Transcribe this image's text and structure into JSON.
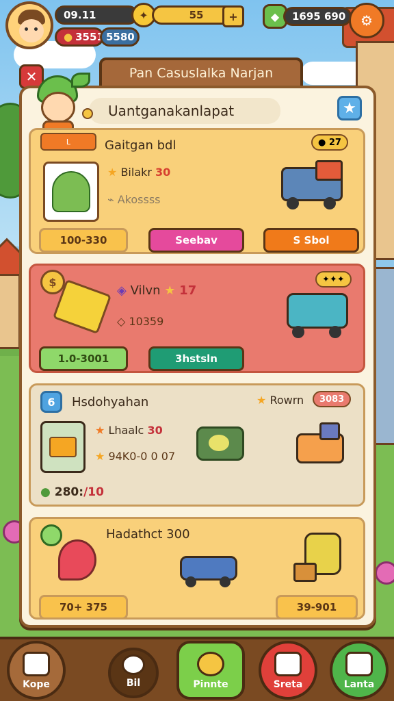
{
  "topbar": {
    "time": "09.11",
    "energy": "55",
    "plus": "+",
    "gems": "1695 690",
    "coins_a": "3551",
    "coins_b": "5580"
  },
  "panel": {
    "title": "Pan Casuslalka Narjan",
    "subtitle": "Uantganakanlapat"
  },
  "cards": [
    {
      "title": "Gaitgan bdl",
      "badge": "27",
      "stat1": "Bilakr",
      "stat1_value": "30",
      "stat2": "Akossss",
      "field": "100-330",
      "btn1": "Seebav",
      "btn2": "S Sbol",
      "tag": "L"
    },
    {
      "title": "Vilvn",
      "title_value": "17",
      "stat": "10359",
      "btn1": "1.0-3001",
      "btn2": "3hstsln"
    },
    {
      "title": "Hsdohyahan",
      "badge_label": "Rowrn",
      "badge_value": "3083",
      "stat1": "Lhaalc",
      "stat1_value": "30",
      "stat2": "94K0-0 0 07",
      "bottom": "280:",
      "bottom_value": "/10"
    },
    {
      "title": "Hadathct 300",
      "field1": "70+ 375",
      "field2": "39-901"
    }
  ],
  "nav": [
    {
      "label": "Kope"
    },
    {
      "label": "Bil"
    },
    {
      "label": "Pinnte"
    },
    {
      "label": "Sreta"
    },
    {
      "label": "Lanta"
    }
  ]
}
